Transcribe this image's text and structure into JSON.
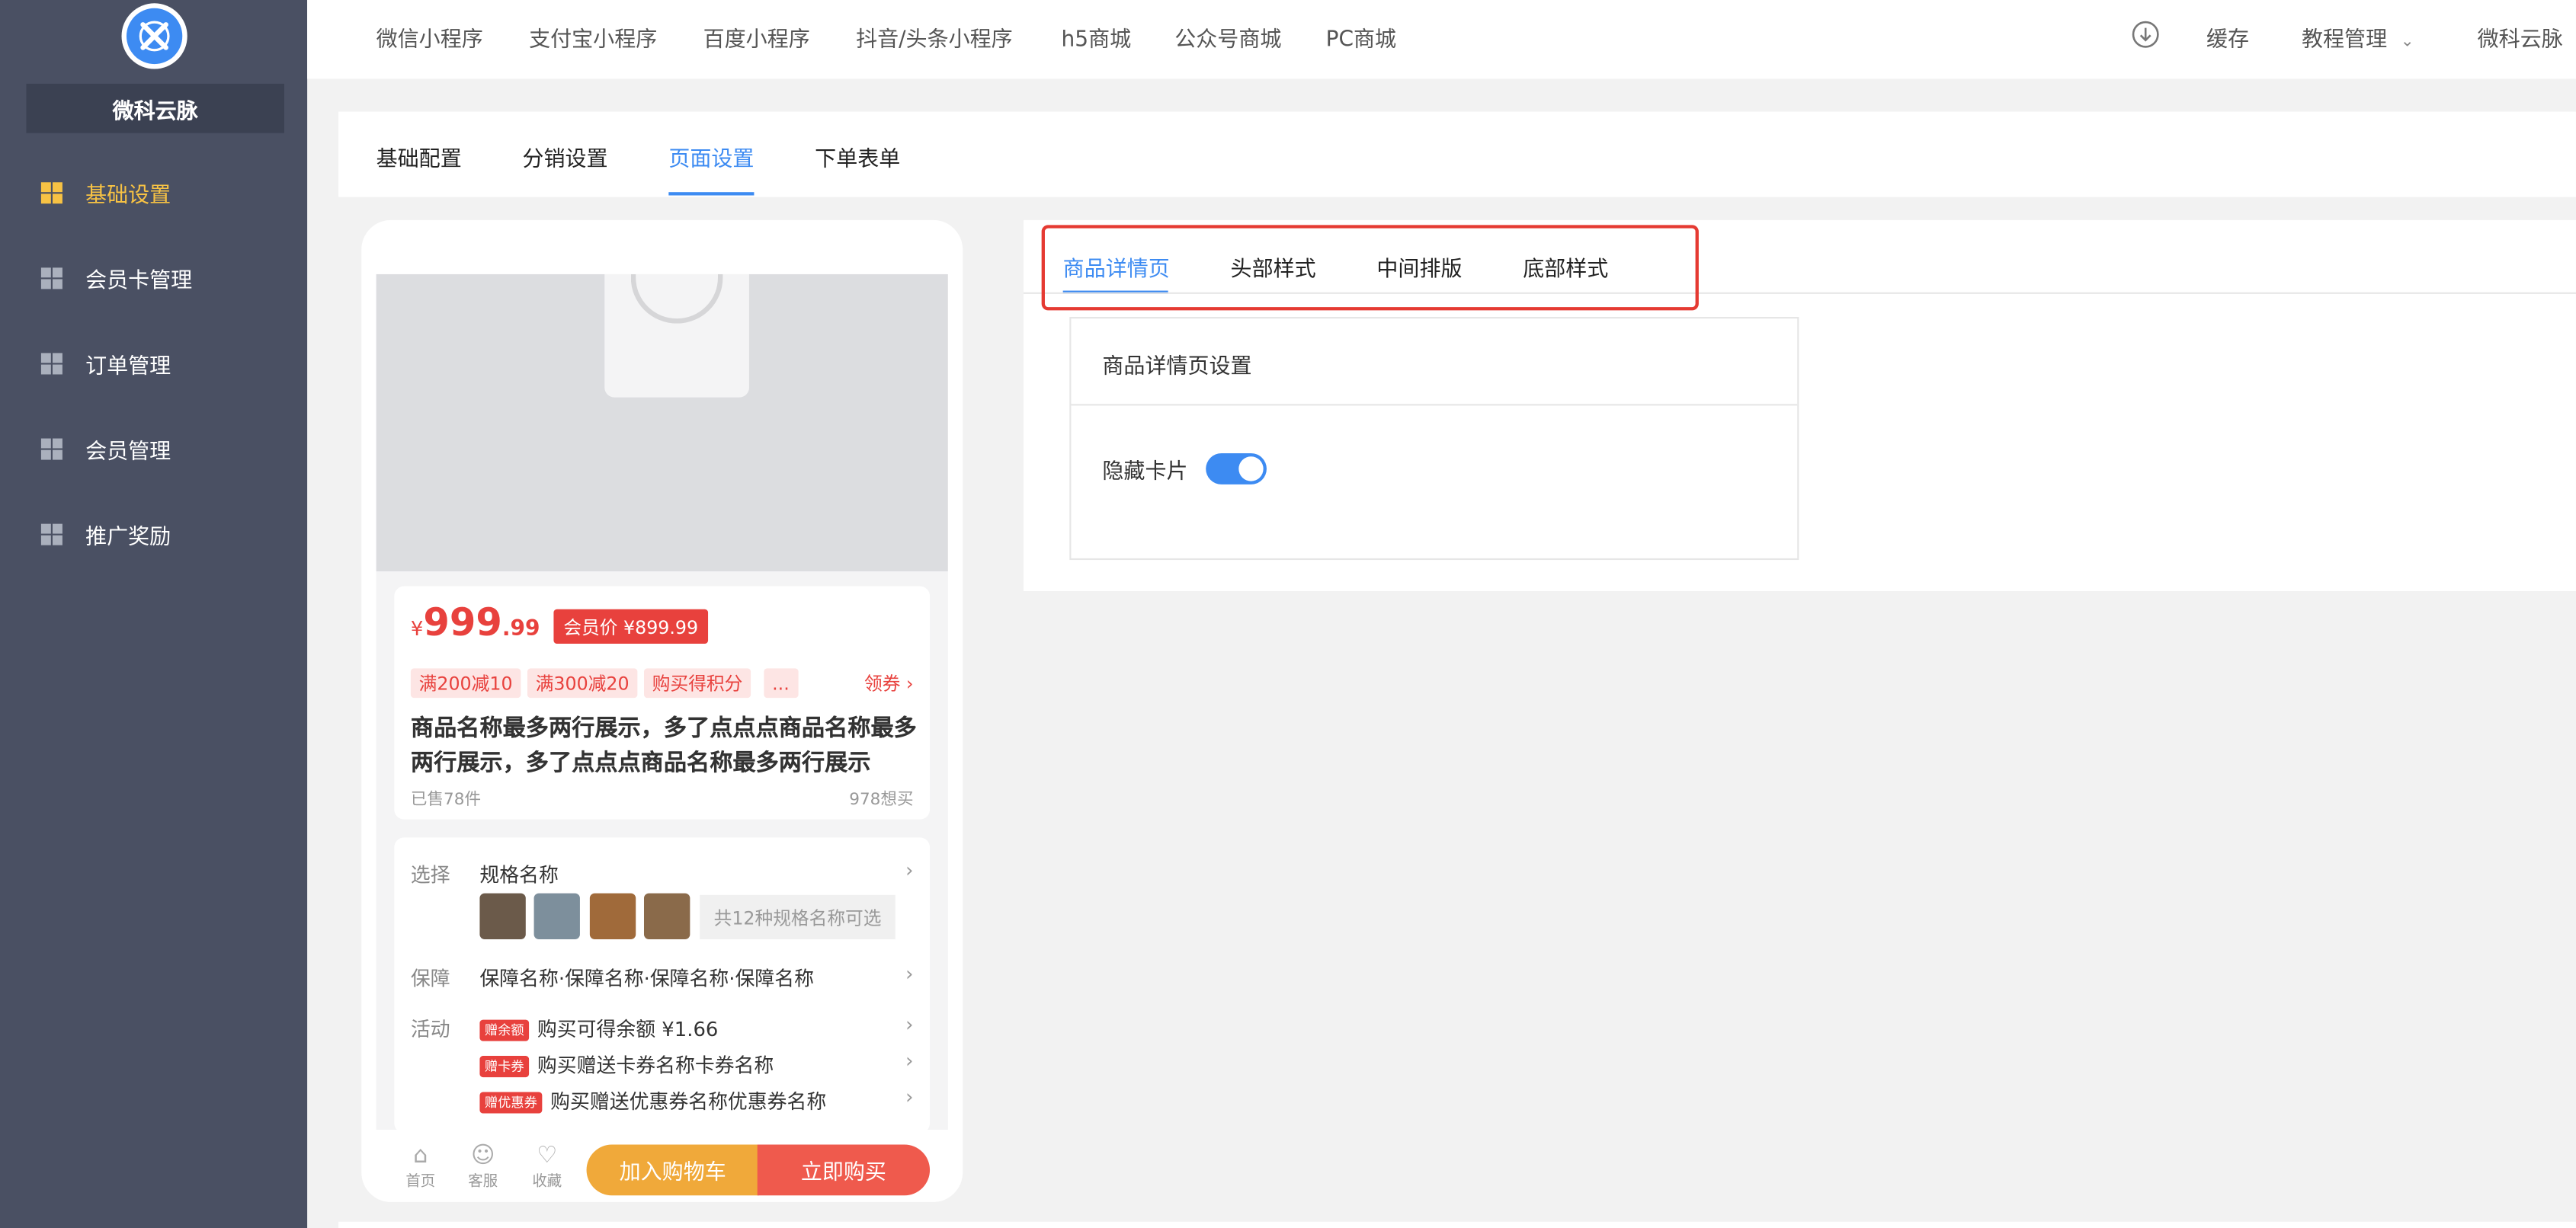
{
  "brand": {
    "name": "微科云脉"
  },
  "sidebar": {
    "items": [
      {
        "label": "基础设置",
        "active": true
      },
      {
        "label": "会员卡管理"
      },
      {
        "label": "订单管理"
      },
      {
        "label": "会员管理"
      },
      {
        "label": "推广奖励"
      }
    ]
  },
  "topnav": {
    "links": [
      "微信小程序",
      "支付宝小程序",
      "百度小程序",
      "抖音/头条小程序",
      "h5商城",
      "公众号商城",
      "PC商城"
    ],
    "cache": "缓存",
    "tutorial": "教程管理",
    "user": "微科云脉"
  },
  "subtabs": [
    "基础配置",
    "分销设置",
    "页面设置",
    "下单表单"
  ],
  "subtab_active": "页面设置",
  "preview": {
    "currency": "¥",
    "price_int": "999",
    "price_dec": ".99",
    "member_price": "会员价 ¥899.99",
    "coupons": [
      "满200减10",
      "满300减20",
      "购买得积分",
      "..."
    ],
    "get_coupon": "领券",
    "product_name": "商品名称最多两行展示，多了点点点商品名称最多两行展示，多了点点点商品名称最多两行展示",
    "sold": "已售78件",
    "wants": "978想买",
    "spec_label": "选择",
    "spec_name": "规格名称",
    "spec_count": "共12种规格名称可选",
    "guarantee_label": "保障",
    "guarantee_text": "保障名称·保障名称·保障名称·保障名称",
    "activity_label": "活动",
    "activities": [
      {
        "tag": "赠余额",
        "text": "购买可得余额 ¥1.66"
      },
      {
        "tag": "赠卡券",
        "text": "购买赠送卡券名称卡券名称"
      },
      {
        "tag": "赠优惠券",
        "text": "购买赠送优惠券名称优惠券名称"
      }
    ],
    "bottom_icons": [
      "首页",
      "客服",
      "收藏"
    ],
    "add_cart": "加入购物车",
    "buy_now": "立即购买"
  },
  "panel": {
    "tabs": [
      "商品详情页",
      "头部样式",
      "中间排版",
      "底部样式"
    ],
    "active_tab": "商品详情页",
    "setting_title": "商品详情页设置",
    "hide_card_label": "隐藏卡片",
    "hide_card_enabled": true
  },
  "colors": {
    "accent": "#3d8bf2",
    "sidebar": "#4a5063",
    "active_nav": "#f7c244",
    "price_red": "#e8413d",
    "highlight_box": "#e53a32"
  }
}
